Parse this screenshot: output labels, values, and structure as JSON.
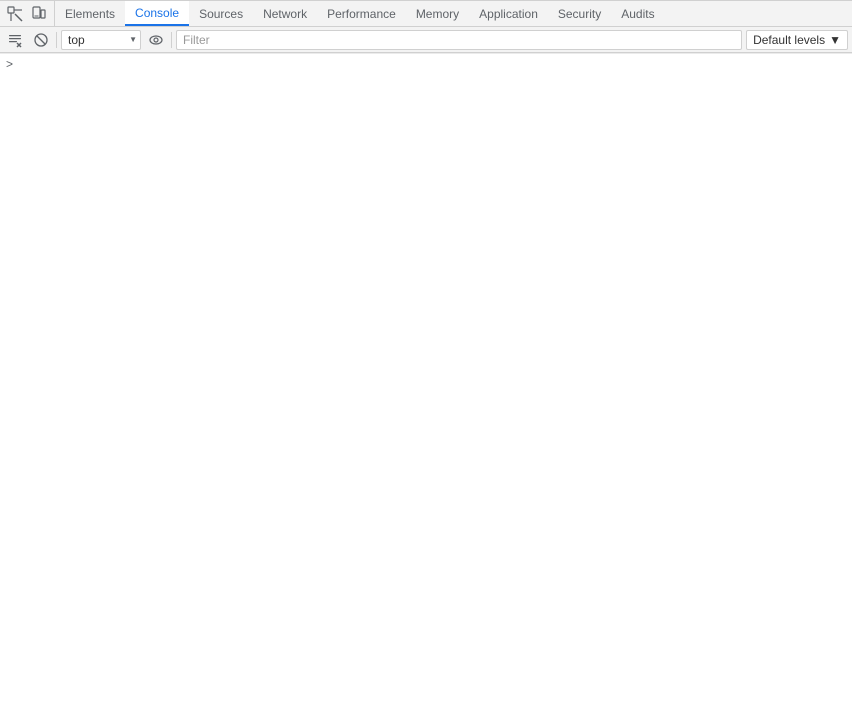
{
  "devtools": {
    "tabs": [
      {
        "id": "elements",
        "label": "Elements",
        "active": false
      },
      {
        "id": "console",
        "label": "Console",
        "active": true
      },
      {
        "id": "sources",
        "label": "Sources",
        "active": false
      },
      {
        "id": "network",
        "label": "Network",
        "active": false
      },
      {
        "id": "performance",
        "label": "Performance",
        "active": false
      },
      {
        "id": "memory",
        "label": "Memory",
        "active": false
      },
      {
        "id": "application",
        "label": "Application",
        "active": false
      },
      {
        "id": "security",
        "label": "Security",
        "active": false
      },
      {
        "id": "audits",
        "label": "Audits",
        "active": false
      }
    ],
    "console": {
      "context": "top",
      "filter_placeholder": "Filter",
      "levels_label": "Default levels",
      "prompt_arrow": ">"
    }
  }
}
